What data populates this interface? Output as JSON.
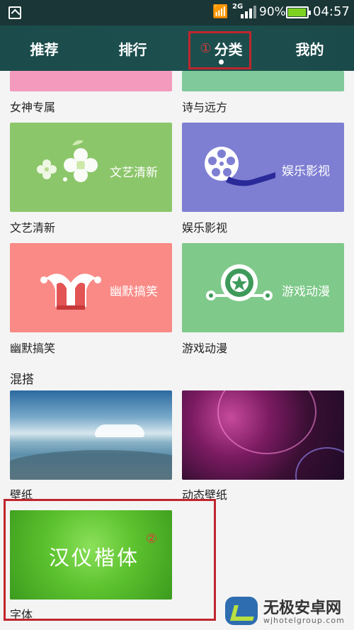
{
  "status_bar": {
    "network_type": "2G",
    "battery_percent": "90%",
    "battery_level": 0.9,
    "time": "04:57",
    "icons": [
      "picture-icon",
      "wifi-icon",
      "signal-icon",
      "battery-icon"
    ]
  },
  "tabs": [
    {
      "label": "推荐",
      "active": false
    },
    {
      "label": "排行",
      "active": false
    },
    {
      "label": "分类",
      "active": true,
      "annotation": "①"
    },
    {
      "label": "我的",
      "active": false
    }
  ],
  "categories": [
    {
      "label": "女神专属",
      "color": "#f49bbd"
    },
    {
      "label": "诗与远方",
      "color": "#7fc99a"
    },
    {
      "label": "文艺清新",
      "tile_text": "文艺清新",
      "color": "#8cc66a",
      "icon": "flower-icon"
    },
    {
      "label": "娱乐影视",
      "tile_text": "娱乐影视",
      "color": "#7e7fd3",
      "icon": "film-reel-icon"
    },
    {
      "label": "幽默搞笑",
      "tile_text": "幽默搞笑",
      "color": "#f98a86",
      "icon": "jester-hat-icon"
    },
    {
      "label": "游戏动漫",
      "tile_text": "游戏动漫",
      "color": "#7fc98a",
      "icon": "star-shield-icon"
    }
  ],
  "mix_section": {
    "title": "混搭",
    "items": [
      {
        "label": "壁纸"
      },
      {
        "label": "动态壁纸"
      },
      {
        "label": "字体",
        "preview_text": "汉仪楷体",
        "annotation": "②"
      }
    ]
  },
  "watermark": {
    "title": "无极安卓网",
    "url": "wjhotelgroup.com"
  }
}
